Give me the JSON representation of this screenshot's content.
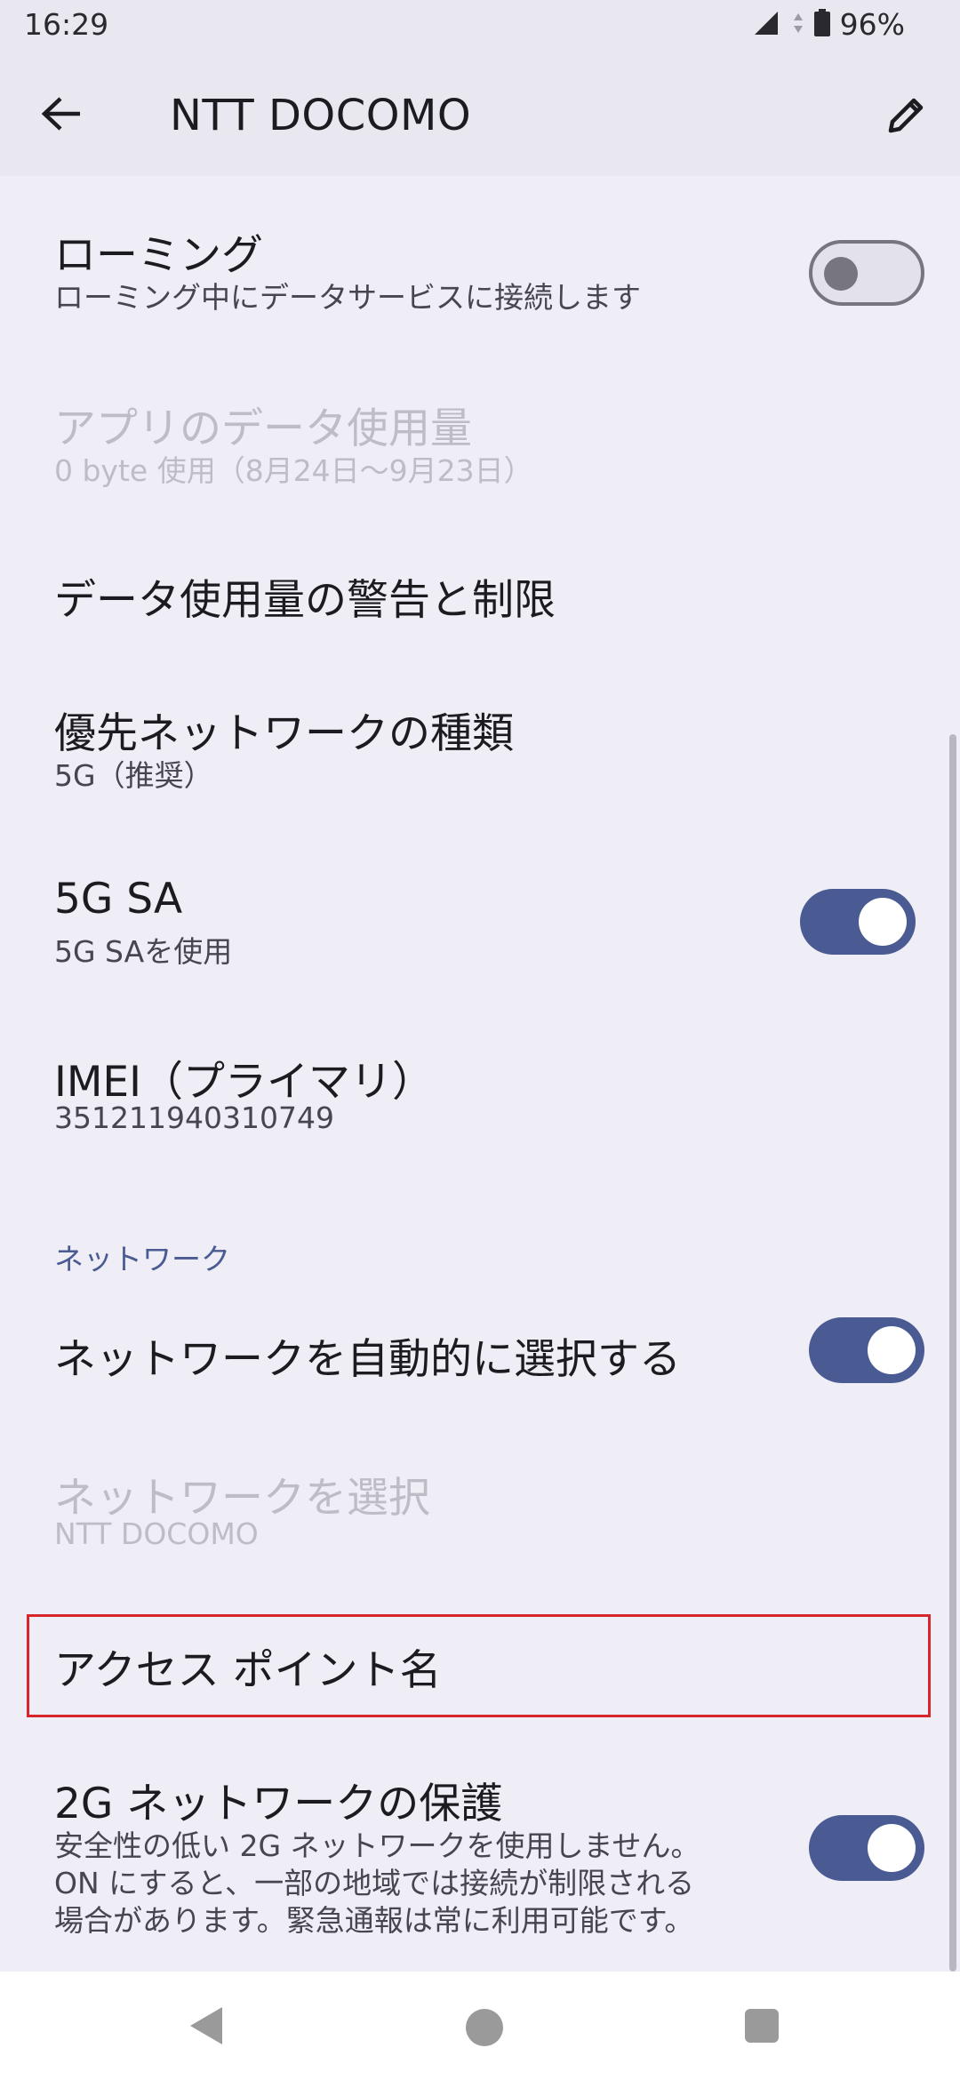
{
  "status_bar": {
    "time": "16:29",
    "battery": "96%"
  },
  "app_bar": {
    "title": "NTT DOCOMO"
  },
  "settings": {
    "roaming": {
      "title": "ローミング",
      "subtitle": "ローミング中にデータサービスに接続します",
      "toggle": "off"
    },
    "app_data_usage": {
      "title": "アプリのデータ使用量",
      "subtitle": "0 byte 使用（8月24日〜9月23日）"
    },
    "data_warning": {
      "title": "データ使用量の警告と制限"
    },
    "preferred_network": {
      "title": "優先ネットワークの種類",
      "subtitle": "5G（推奨）"
    },
    "five_g_sa": {
      "title": "5G SA",
      "subtitle": "5G SAを使用",
      "toggle": "on"
    },
    "imei": {
      "title": "IMEI（プライマリ）",
      "subtitle": "351211940310749"
    },
    "network_section": {
      "header": "ネットワーク"
    },
    "auto_network": {
      "title": "ネットワークを自動的に選択する",
      "toggle": "on"
    },
    "select_network": {
      "title": "ネットワークを選択",
      "subtitle": "NTT DOCOMO"
    },
    "apn": {
      "title": "アクセス ポイント名"
    },
    "two_g_protection": {
      "title": "2G ネットワークの保護",
      "line1": "安全性の低い 2G ネットワークを使用しません。",
      "line2": "ON にすると、一部の地域では接続が制限される",
      "line3": "場合があります。緊急通報は常に利用可能です。",
      "toggle": "on"
    }
  },
  "colors": {
    "accent": "#4A5A92",
    "background": "#EFEDF5",
    "highlight": "#D6262C"
  },
  "icons": {
    "back": "arrow-left-icon",
    "edit": "pencil-icon",
    "signal": "signal-icon",
    "battery": "battery-icon"
  }
}
